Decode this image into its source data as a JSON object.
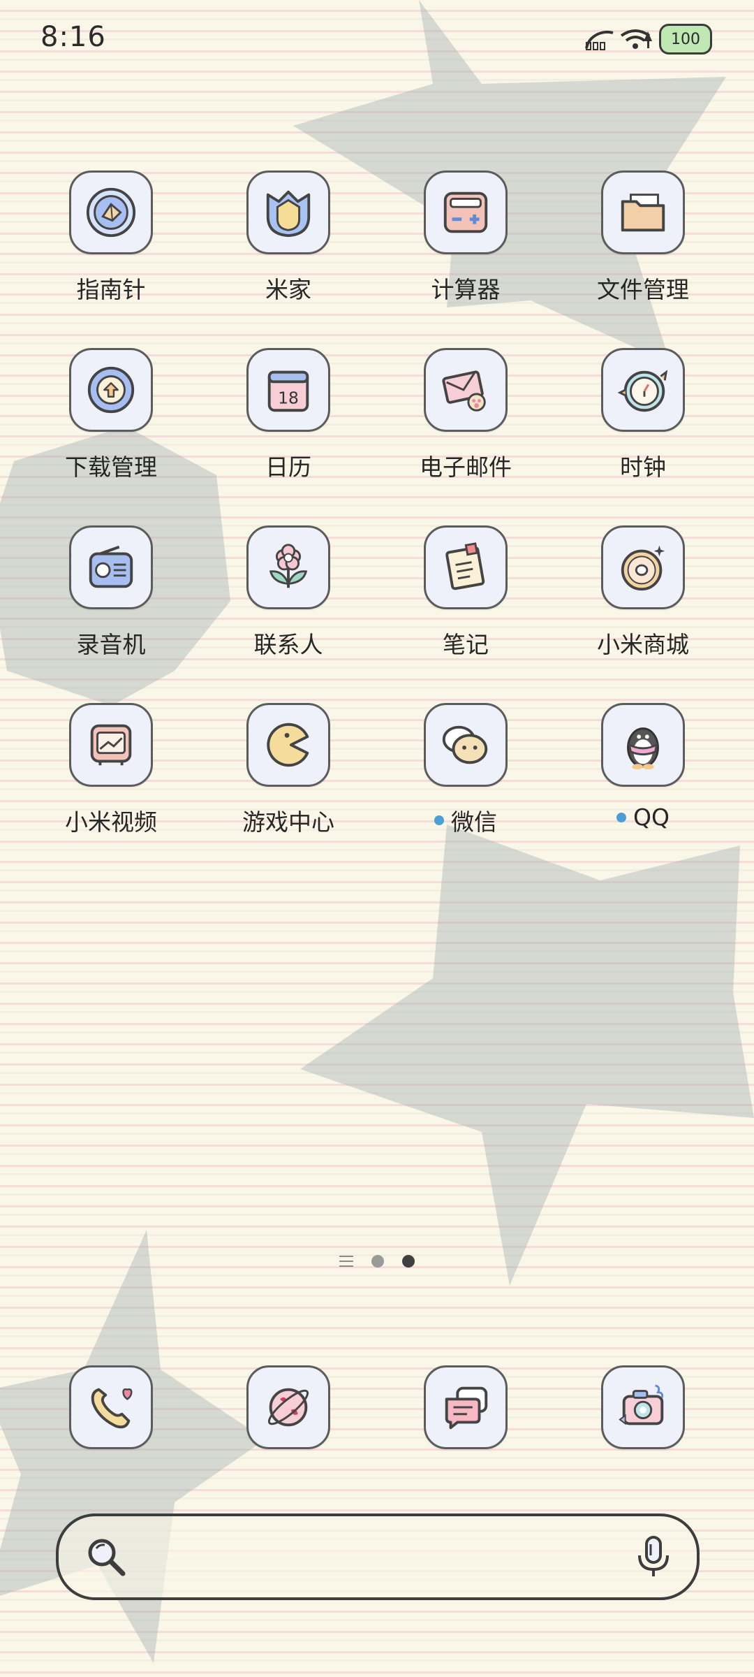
{
  "status_bar": {
    "time": "8:16",
    "battery": "100"
  },
  "apps": [
    {
      "label": "指南针",
      "icon": "compass-icon"
    },
    {
      "label": "米家",
      "icon": "mijia-icon"
    },
    {
      "label": "计算器",
      "icon": "calculator-icon"
    },
    {
      "label": "文件管理",
      "icon": "folder-icon"
    },
    {
      "label": "下载管理",
      "icon": "download-icon"
    },
    {
      "label": "日历",
      "icon": "calendar-icon",
      "calendar_day": "18"
    },
    {
      "label": "电子邮件",
      "icon": "mail-icon"
    },
    {
      "label": "时钟",
      "icon": "clock-icon"
    },
    {
      "label": "录音机",
      "icon": "radio-icon"
    },
    {
      "label": "联系人",
      "icon": "flower-icon"
    },
    {
      "label": "笔记",
      "icon": "note-icon"
    },
    {
      "label": "小米商城",
      "icon": "donut-icon"
    },
    {
      "label": "小米视频",
      "icon": "tv-icon"
    },
    {
      "label": "游戏中心",
      "icon": "pacman-icon"
    },
    {
      "label": "微信",
      "icon": "chat-bubble-icon",
      "new_dot": true
    },
    {
      "label": "QQ",
      "icon": "penguin-icon",
      "new_dot": true
    }
  ],
  "dock": [
    {
      "icon": "phone-icon"
    },
    {
      "icon": "browser-planet-icon"
    },
    {
      "icon": "messages-icon"
    },
    {
      "icon": "camera-icon"
    }
  ],
  "colors": {
    "tile": "#eef0fa",
    "new_dot": "#4b9fd5",
    "battery": "#bfe8b3"
  }
}
